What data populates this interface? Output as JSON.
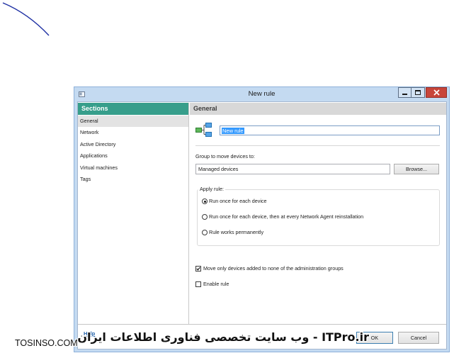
{
  "window": {
    "title": "New rule",
    "icon": "app-window-icon",
    "controls": {
      "minimize": "minimize-icon",
      "maximize": "maximize-icon",
      "close": "close-icon"
    }
  },
  "sidebar": {
    "title": "Sections",
    "items": [
      {
        "label": "General",
        "selected": true
      },
      {
        "label": "Network",
        "selected": false
      },
      {
        "label": "Active Directory",
        "selected": false
      },
      {
        "label": "Applications",
        "selected": false
      },
      {
        "label": "Virtual machines",
        "selected": false
      },
      {
        "label": "Tags",
        "selected": false
      }
    ]
  },
  "main": {
    "title": "General",
    "rule_icon": "rule-tree-icon",
    "rule_name": "New rule",
    "rule_name_selected": true,
    "group_label": "Group to move devices to:",
    "group_value": "Managed devices",
    "browse_label": "Browse...",
    "apply_rule": {
      "label": "Apply rule:",
      "options": [
        {
          "label": "Run once for each device",
          "checked": true
        },
        {
          "label": "Run once for each device, then at every Network Agent reinstallation",
          "checked": false
        },
        {
          "label": "Rule works permanently",
          "checked": false
        }
      ]
    },
    "move_only_unassigned": {
      "label": "Move only devices added to none of the administration groups",
      "checked": true
    },
    "enable_rule": {
      "label": "Enable rule",
      "checked": false
    }
  },
  "footer": {
    "help_label": "Help",
    "ok_label": "OK",
    "cancel_label": "Cancel"
  },
  "watermark": {
    "site": "TOSINSO.COM",
    "text": "ITPro.ir - وب سایت تخصصی فناوری اطلاعات ایران"
  },
  "colors": {
    "title_bar": "#c4daf1",
    "sections_header": "#379e8b",
    "panel_header": "#d8d8d8",
    "close_button": "#c8453a",
    "text_selection": "#3399ff",
    "link": "#1f5fa8",
    "decorative_arc": "#1d2fa3"
  }
}
